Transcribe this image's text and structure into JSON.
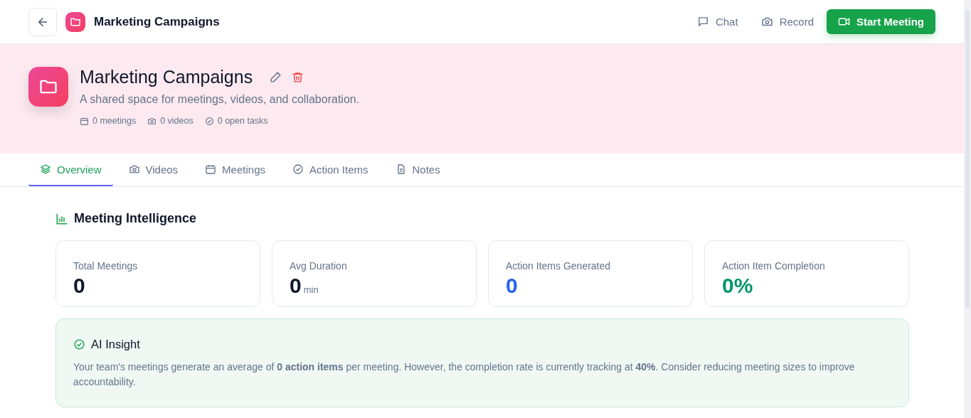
{
  "header": {
    "title": "Marketing Campaigns",
    "actions": [
      {
        "label": "Chat",
        "kind": "chat"
      },
      {
        "label": "Record",
        "kind": "record"
      }
    ],
    "primary_button": "Start Meeting"
  },
  "workspace": {
    "title": "Marketing Campaigns",
    "description": "A shared space for meetings, videos, and collaboration.",
    "stats": [
      {
        "label": "0 meetings",
        "kind": "calendar"
      },
      {
        "label": "0 videos",
        "kind": "camera"
      },
      {
        "label": "0 open tasks",
        "kind": "check"
      }
    ]
  },
  "tabs": [
    {
      "label": "Overview",
      "kind": "layers",
      "selected": true
    },
    {
      "label": "Videos",
      "kind": "camera",
      "selected": false
    },
    {
      "label": "Meetings",
      "kind": "calendar",
      "selected": false
    },
    {
      "label": "Action Items",
      "kind": "check",
      "selected": false
    },
    {
      "label": "Notes",
      "kind": "document",
      "selected": false
    }
  ],
  "section": {
    "title": "Meeting Intelligence",
    "metrics": [
      {
        "label": "Total Meetings",
        "value": "0",
        "color": "#0f172a"
      },
      {
        "label": "Avg Duration",
        "value": "0",
        "unit": "min",
        "color": "#0f172a"
      },
      {
        "label": "Action Items Generated",
        "value": "0",
        "color": "#2563eb"
      },
      {
        "label": "Action Item Completion",
        "value": "0%",
        "color": "#059669"
      }
    ]
  },
  "insight": {
    "title": "AI Insight",
    "text": "Your team's meetings generate an average of **0 action items** per meeting. However, the completion rate is currently tracking at **40%**. Consider reducing meeting sizes to improve accountability."
  }
}
